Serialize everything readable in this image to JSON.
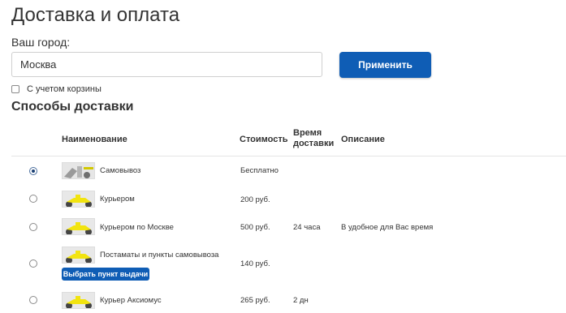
{
  "page_title": "Доставка и оплата",
  "city": {
    "label": "Ваш город:",
    "value": "Москва",
    "apply_label": "Применить"
  },
  "cart_option": {
    "label": "С учетом корзины",
    "checked": false
  },
  "section_title": "Способы доставки",
  "table": {
    "headers": {
      "name": "Наименование",
      "cost": "Стоимость",
      "time": "Время доставки",
      "desc": "Описание"
    },
    "rows": [
      {
        "name": "Самовывоз",
        "cost": "Бесплатно",
        "time": "",
        "desc": "",
        "selected": true,
        "icon": "pickup-image"
      },
      {
        "name": "Курьером",
        "cost": "200 руб.",
        "time": "",
        "desc": "",
        "selected": false,
        "icon": "scooter-image"
      },
      {
        "name": "Курьером по Москве",
        "cost": "500 руб.",
        "time": "24 часа",
        "desc": "В удобное для Вас время",
        "selected": false,
        "icon": "scooter-image"
      },
      {
        "name": "Постаматы и пункты самовывоза",
        "cost": "140 руб.",
        "time": "",
        "desc": "",
        "selected": false,
        "icon": "scooter-image",
        "button": "Выбрать пункт выдачи"
      },
      {
        "name": "Курьер Аксиомус",
        "cost": "265 руб.",
        "time": "2 дн",
        "desc": "",
        "selected": false,
        "icon": "scooter-image"
      }
    ]
  },
  "colors": {
    "accent": "#0f5db5",
    "text": "#333333",
    "scooter": "#f2e40f"
  }
}
